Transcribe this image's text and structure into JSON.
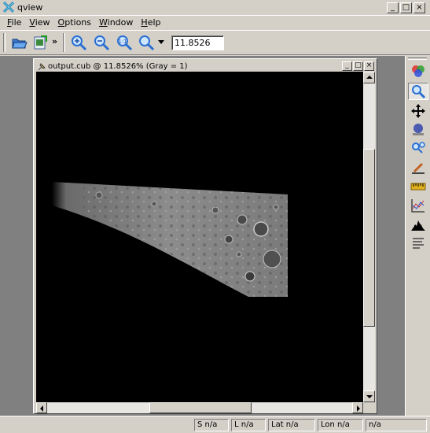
{
  "window": {
    "title": "qview",
    "btn_min": "_",
    "btn_max": "□",
    "btn_close": "×"
  },
  "menus": [
    {
      "label": "File",
      "u": "F",
      "rest": "ile"
    },
    {
      "label": "View",
      "u": "V",
      "rest": "iew"
    },
    {
      "label": "Options",
      "u": "O",
      "rest": "ptions"
    },
    {
      "label": "Window",
      "u": "W",
      "rest": "indow"
    },
    {
      "label": "Help",
      "u": "H",
      "rest": "elp"
    }
  ],
  "toolbar": {
    "more": "»",
    "zoom_value": "11.8526",
    "icons": [
      "open-folder-icon",
      "export-icon",
      "zoom-in-icon",
      "zoom-out-icon",
      "zoom-actual-icon",
      "zoom-fit-icon"
    ]
  },
  "subwindow": {
    "title": "output.cub @ 11.8526% (Gray = 1)",
    "btn_min": "_",
    "btn_max": "□",
    "btn_close": "×"
  },
  "right_tools": [
    "color-blend-icon",
    "zoom-tool-icon",
    "pan-tool-icon",
    "stretch-tool-icon",
    "find-tool-icon",
    "edit-tool-icon",
    "measure-tool-icon",
    "spectral-plot-icon",
    "histogram-icon",
    "advanced-tracking-icon"
  ],
  "status": {
    "s": "S n/a",
    "l": "L n/a",
    "lat": "Lat n/a",
    "lon": "Lon n/a",
    "dn": "n/a"
  },
  "colors": {
    "chrome": "#d4d0c8",
    "workspace": "#808080",
    "viewport": "#000000",
    "accent_blue": "#2a6fd1"
  }
}
